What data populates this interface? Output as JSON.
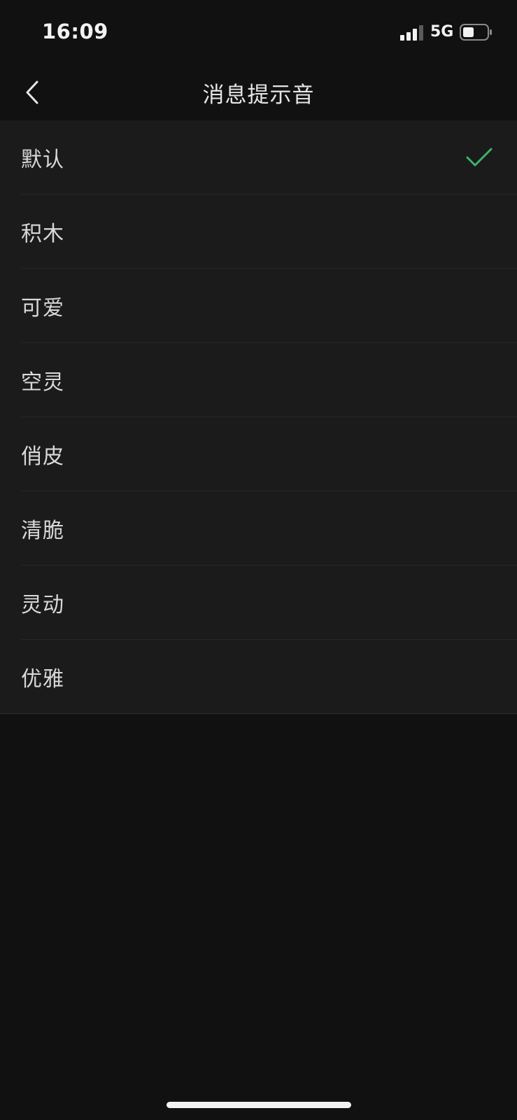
{
  "status_bar": {
    "time": "16:09",
    "network": "5G"
  },
  "header": {
    "title": "消息提示音"
  },
  "sound_options": [
    {
      "label": "默认",
      "selected": true
    },
    {
      "label": "积木",
      "selected": false
    },
    {
      "label": "可爱",
      "selected": false
    },
    {
      "label": "空灵",
      "selected": false
    },
    {
      "label": "俏皮",
      "selected": false
    },
    {
      "label": "清脆",
      "selected": false
    },
    {
      "label": "灵动",
      "selected": false
    },
    {
      "label": "优雅",
      "selected": false
    }
  ],
  "colors": {
    "background": "#111111",
    "list_background": "#1b1b1b",
    "check": "#3fb36b"
  },
  "icons": {
    "back": "chevron-left-icon",
    "selected": "checkmark-icon",
    "signal": "cellular-signal-icon",
    "battery": "battery-icon"
  }
}
